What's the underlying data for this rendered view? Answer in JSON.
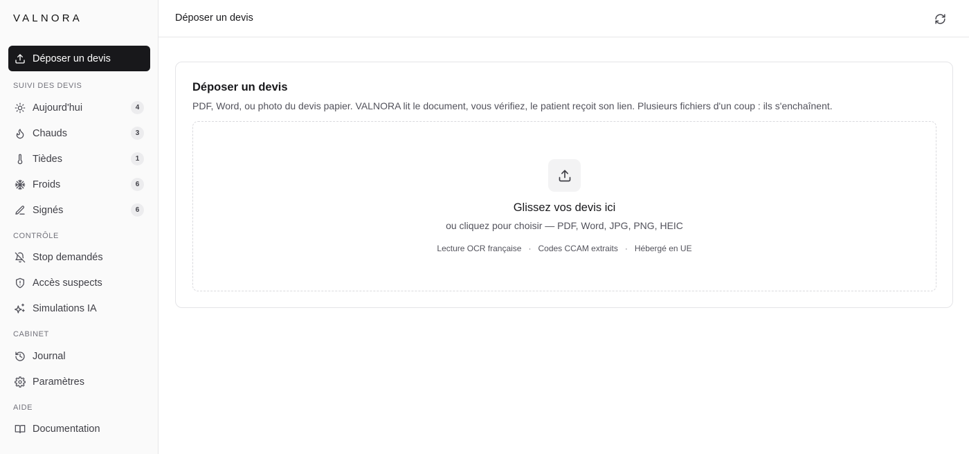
{
  "app": {
    "logo": "VALNORA"
  },
  "sidebar": {
    "primary": {
      "label": "Déposer un devis",
      "icon": "upload-icon"
    },
    "sections": [
      {
        "title": "SUIVI DES DEVIS"
      },
      {
        "title": "CONTRÔLE"
      },
      {
        "title": "CABINET"
      },
      {
        "title": "AIDE"
      }
    ],
    "items": [
      {
        "label": "Aujourd'hui",
        "count": "4",
        "icon": "sun-icon"
      },
      {
        "label": "Chauds",
        "count": "3",
        "icon": "flame-icon"
      },
      {
        "label": "Tièdes",
        "count": "1",
        "icon": "thermometer-icon"
      },
      {
        "label": "Froids",
        "count": "6",
        "icon": "snowflake-icon"
      },
      {
        "label": "Signés",
        "count": "6",
        "icon": "pen-icon"
      },
      {
        "label": "Stop demandés",
        "icon": "bell-off-icon"
      },
      {
        "label": "Accès suspects",
        "icon": "shield-icon"
      },
      {
        "label": "Simulations IA",
        "icon": "sparkles-icon"
      },
      {
        "label": "Journal",
        "icon": "history-icon"
      },
      {
        "label": "Paramètres",
        "icon": "gear-icon"
      },
      {
        "label": "Documentation",
        "icon": "book-icon"
      }
    ]
  },
  "header": {
    "title": "Déposer un devis",
    "refresh_icon": "refresh-icon"
  },
  "card": {
    "title": "Déposer un devis",
    "description": "PDF, Word, ou photo du devis papier. VALNORA lit le document, vous vérifiez, le patient reçoit son lien. Plusieurs fichiers d'un coup : ils s'enchaînent.",
    "dropzone": {
      "title": "Glissez vos devis ici",
      "subtitle": "ou cliquez pour choisir — PDF, Word, JPG, PNG, HEIC",
      "features": [
        "Lecture OCR française",
        "Codes CCAM extraits",
        "Hébergé en UE"
      ],
      "separator": "·"
    }
  },
  "colors": {
    "active_bg": "#18181b",
    "badge_bg": "#ececee",
    "border": "#e4e4e7"
  }
}
